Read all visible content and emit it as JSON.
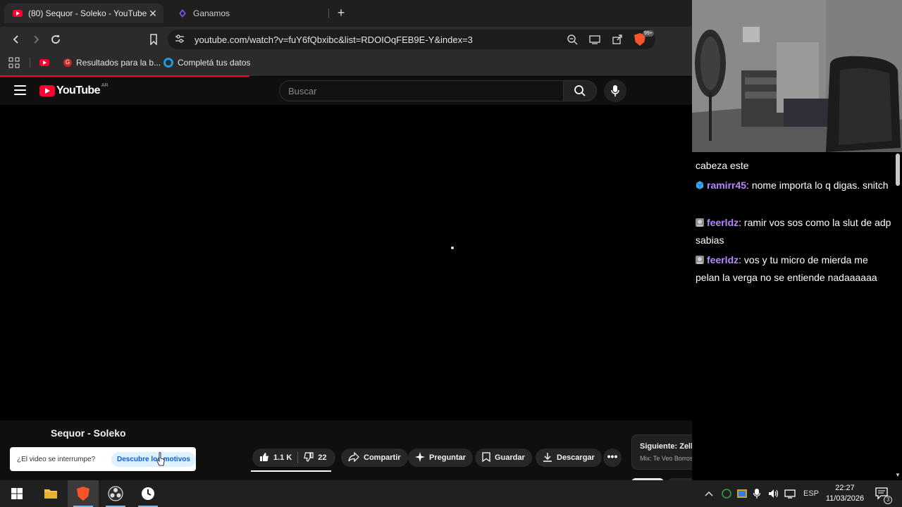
{
  "browser": {
    "tabs": [
      {
        "title": "(80) Sequor - Soleko - YouTube",
        "active": true,
        "close": "✕"
      },
      {
        "title": "Ganamos",
        "active": false
      }
    ],
    "new_tab": "+",
    "url": "youtube.com/watch?v=fuY6fQbxibc&list=RDOIOqFEB9E-Y&index=3",
    "shield_badge": "99+",
    "bookmarks": [
      {
        "label": "Resultados para la b...",
        "icon": "google-g-icon"
      },
      {
        "label": "Completá tus datos",
        "icon": "ring-icon"
      }
    ],
    "load_progress": 0.36
  },
  "youtube": {
    "logo_text": "YouTube",
    "region": "AR",
    "search_placeholder": "Buscar",
    "video_title": "Sequor - Soleko",
    "likes": "1.1 K",
    "dislikes": "22",
    "actions": [
      {
        "label": "Compartir",
        "icon": "share-icon"
      },
      {
        "label": "Preguntar",
        "icon": "sparkle-icon"
      },
      {
        "label": "Guardar",
        "icon": "bookmark-icon"
      },
      {
        "label": "Descargar",
        "icon": "download-icon"
      }
    ],
    "more": "•••",
    "next": {
      "title": "Siguiente: Zell - el infierno en persona (Video Oficial)",
      "subtitle": "Mix: Te Veo Borrosa"
    },
    "toast": {
      "question": "¿El video se interrumpe?",
      "link": "Descubre los motivos"
    }
  },
  "chat": {
    "messages": [
      {
        "user": "",
        "text": "cabeza este",
        "badge": ""
      },
      {
        "user": "ramirr45",
        "text": "nome importa lo q digas. snitch",
        "badge": "cube-badge"
      },
      {
        "user": "feerldz",
        "text": "ramir vos sos como la slut de adp sabias",
        "badge": "avatar-badge"
      },
      {
        "user": "feerldz",
        "text": "vos y tu micro de mierda me pelan la verga no se entiende nadaaaaaa",
        "badge": "avatar-badge"
      }
    ]
  },
  "taskbar": {
    "language": "ESP",
    "time": "22:27",
    "date": "11/03/2026",
    "notifications": "3"
  },
  "colors": {
    "youtube_red": "#ff0033",
    "chat_username": "#b987ff",
    "brave_orange": "#fb542b",
    "link_blue": "#065fd4"
  }
}
